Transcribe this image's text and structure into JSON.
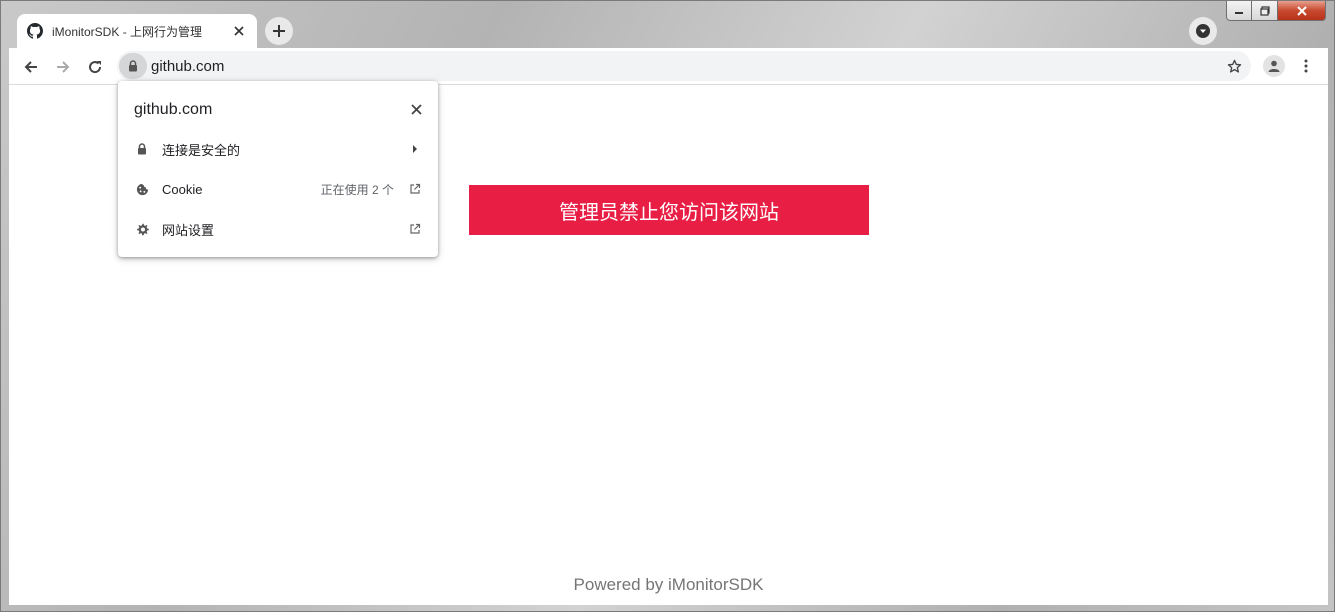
{
  "browser": {
    "tab": {
      "title": "iMonitorSDK - 上网行为管理",
      "favicon": "github-icon"
    },
    "address_bar": {
      "url": "github.com",
      "security_icon": "lock-icon"
    }
  },
  "site_info_popup": {
    "title": "github.com",
    "items": [
      {
        "icon": "lock-icon",
        "label": "连接是安全的",
        "trailing": "chevron-right-icon"
      },
      {
        "icon": "cookie-icon",
        "label": "Cookie",
        "value": "正在使用 2 个",
        "trailing": "external-link-icon"
      },
      {
        "icon": "gear-icon",
        "label": "网站设置",
        "trailing": "external-link-icon"
      }
    ]
  },
  "page": {
    "block_message": "管理员禁止您访问该网站",
    "footer": "Powered by iMonitorSDK"
  },
  "colors": {
    "block_banner": "#e91e45",
    "footer_text": "#757575"
  }
}
